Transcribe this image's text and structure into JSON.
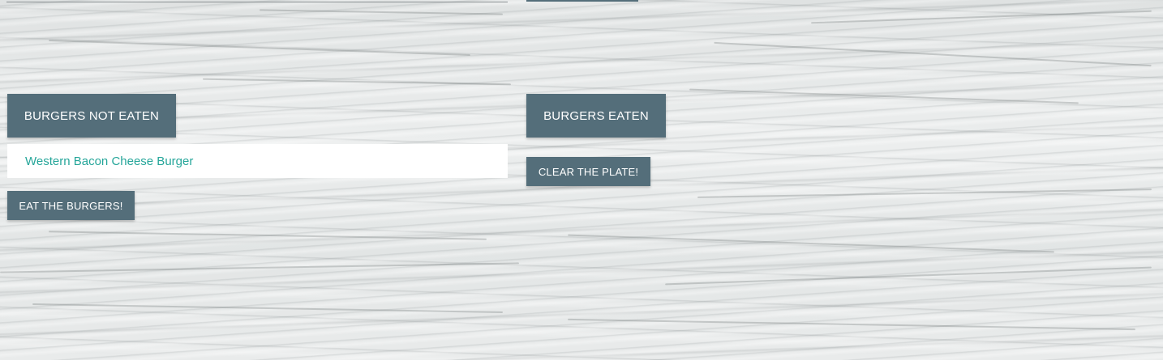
{
  "not_eaten": {
    "header_label": "BURGERS NOT EATEN",
    "items": [
      {
        "name": "Western Bacon Cheese Burger"
      }
    ],
    "eat_button_label": "EAT THE BURGERS!"
  },
  "eaten": {
    "header_label": "BURGERS EATEN",
    "clear_button_label": "CLEAR THE PLATE!"
  },
  "colors": {
    "button_bg": "#546e7a",
    "button_text": "#ffffff",
    "item_text": "#26a69a",
    "item_bg": "#ffffff"
  }
}
